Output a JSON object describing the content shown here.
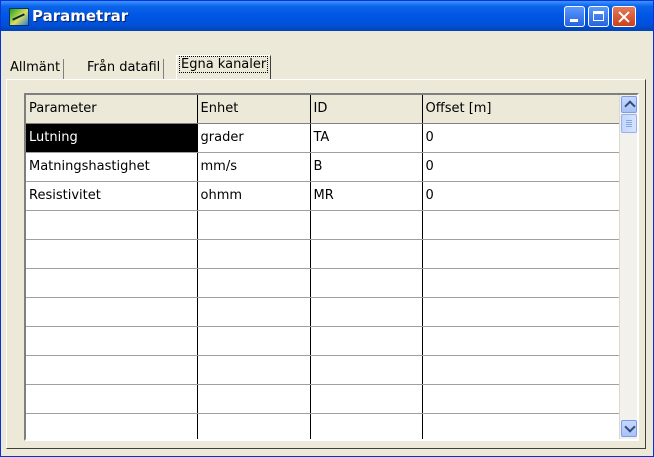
{
  "window": {
    "title": "Parametrar",
    "icon": "app-chart-icon"
  },
  "tabs": [
    {
      "label": "Allmänt",
      "active": false
    },
    {
      "label": "Från datafil",
      "active": false
    },
    {
      "label": "Egna kanaler",
      "active": true
    }
  ],
  "table": {
    "columns": [
      "Parameter",
      "Enhet",
      "ID",
      "Offset [m]"
    ],
    "rows": [
      [
        "Lutning",
        "grader",
        "TA",
        "0"
      ],
      [
        "Matningshastighet",
        "mm/s",
        "B",
        "0"
      ],
      [
        "Resistivitet",
        "ohmm",
        "MR",
        "0"
      ],
      [
        "",
        "",
        "",
        ""
      ],
      [
        "",
        "",
        "",
        ""
      ],
      [
        "",
        "",
        "",
        ""
      ],
      [
        "",
        "",
        "",
        ""
      ],
      [
        "",
        "",
        "",
        ""
      ],
      [
        "",
        "",
        "",
        ""
      ],
      [
        "",
        "",
        "",
        ""
      ],
      [
        "",
        "",
        "",
        ""
      ]
    ],
    "selected_cell": "Lutning"
  },
  "colors": {
    "titlebar": "#0055e5",
    "background": "#ece9d8",
    "selected": "#000000"
  }
}
